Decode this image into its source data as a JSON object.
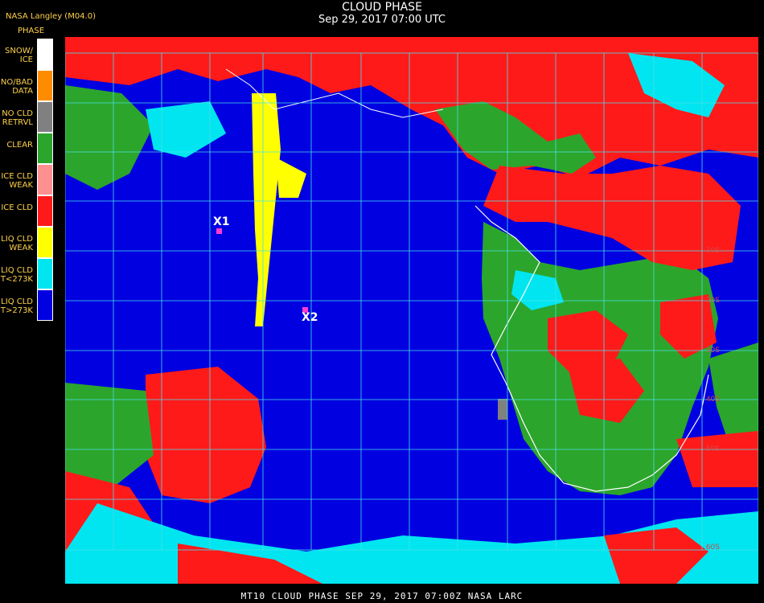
{
  "title": "CLOUD PHASE",
  "subtitle": "Sep 29, 2017 07:00 UTC",
  "credit": "NASA Langley (M04.0)",
  "legend_title": "PHASE",
  "legend": [
    {
      "label": "SNOW/\nICE",
      "color": "#ffffff"
    },
    {
      "label": "NO/BAD\nDATA",
      "color": "#ff8c00"
    },
    {
      "label": "NO CLD\nRETRVL",
      "color": "#808080"
    },
    {
      "label": "CLEAR",
      "color": "#2ca52c"
    },
    {
      "label": "ICE CLD\nWEAK",
      "color": "#ff9090"
    },
    {
      "label": "ICE CLD",
      "color": "#ff1a1a"
    },
    {
      "label": "LIQ CLD\nWEAK",
      "color": "#ffff00"
    },
    {
      "label": "LIQ CLD\nT<273K",
      "color": "#00e5f0"
    },
    {
      "label": "LIQ CLD\nT>273K",
      "color": "#0000e0"
    }
  ],
  "markers": [
    {
      "label": "X1",
      "color": "#ff3bd0"
    },
    {
      "label": "X2",
      "color": "#ff3bd0"
    }
  ],
  "lat_labels": [
    "10S",
    "20S",
    "30S",
    "40S",
    "50S",
    "60S"
  ],
  "footer": "MT10  CLOUD PHASE   SEP 29, 2017 07:00Z   NASA LARC",
  "colors": {
    "ocean_liquid": "#0000e0",
    "ice": "#ff1a1a",
    "clear": "#2ca52c",
    "cold_liquid": "#00e5f0",
    "weak_liquid": "#ffff00",
    "grid": "#48e0e8",
    "coast": "#ffffff"
  }
}
